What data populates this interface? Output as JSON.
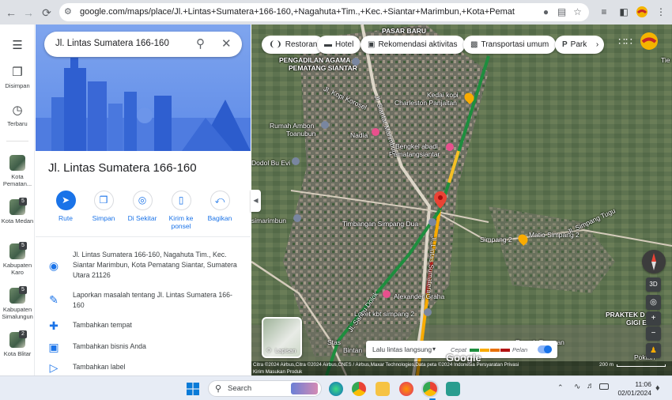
{
  "browser": {
    "url": "google.com/maps/place/Jl.+Lintas+Sumatera+166-160,+Nagahuta+Tim.,+Kec.+Siantar+Marimbun,+Kota+Pematang+Siantar,+Sumatera..."
  },
  "rail": {
    "items": [
      {
        "label": "Disimpan"
      },
      {
        "label": "Terbaru"
      }
    ],
    "recent": [
      {
        "label": "Kota Pematan...",
        "badge": ""
      },
      {
        "label": "Kota Medan",
        "badge": "5"
      },
      {
        "label": "Kabupaten Karo",
        "badge": "5"
      },
      {
        "label": "Kabupaten Simalungun",
        "badge": "5"
      },
      {
        "label": "Kota Blitar",
        "badge": "2"
      }
    ]
  },
  "panel": {
    "search_value": "Jl. Lintas Sumatera 166-160",
    "title": "Jl. Lintas Sumatera 166-160",
    "actions": [
      {
        "label": "Rute"
      },
      {
        "label": "Simpan"
      },
      {
        "label": "Di Sekitar"
      },
      {
        "label": "Kirim ke ponsel"
      },
      {
        "label": "Bagikan"
      }
    ],
    "address": "Jl. Lintas Sumatera 166-160, Nagahuta Tim., Kec. Siantar Marimbun, Kota Pematang Siantar, Sumatera Utara 21126",
    "report": "Laporkan masalah tentang Jl. Lintas Sumatera 166-160",
    "add_place": "Tambahkan tempat",
    "add_business": "Tambahkan bisnis Anda",
    "add_label": "Tambahkan label"
  },
  "map": {
    "chips": [
      {
        "label": "Restoran",
        "icon": "fork-knife-icon"
      },
      {
        "label": "Hotel",
        "icon": "bed-icon"
      },
      {
        "label": "Rekomendasi aktivitas",
        "icon": "camera-icon"
      },
      {
        "label": "Transportasi umum",
        "icon": "bus-icon"
      },
      {
        "label": "Park",
        "icon": "parking-icon"
      }
    ],
    "labels": {
      "pasar_baru": "PASAR BARU",
      "pengadilan_1": "PENGADILAN AGAMA",
      "pengadilan_2": "PEMATANG SIANTAR",
      "kedai_1": "Kedai kopi",
      "kedai_2": "Charleston Panjaitan",
      "rumah_ambon_1": "Rumah Ambon",
      "rumah_ambon_2": "Toanubun",
      "nadia": "Nadia",
      "bengkel_1": "Bengkel abadi",
      "bengkel_2": "Pematangsiantar",
      "dodol": "Dodol Bu Evi",
      "simarimbun": "simarimbun",
      "timbangan": "Timbangan Simpang Dua",
      "simpang2": "Simpang 2",
      "matio": "Matio Simpang 2",
      "alexander": "Alexander Graha",
      "loket": "Loket kbt simpang 2",
      "stas": "Stas",
      "bintan": "Bintan",
      "rumah_pagaran": "Rumah Pagaran",
      "praktek_1": "PRAKTEK D",
      "praktek_2": "GIGI E",
      "poktan": "Poktan",
      "tie": "Tie"
    },
    "road_labels": {
      "jl_lintas": "Jl. Lintas Sumatera",
      "jl_siantar": "Jl. Siantar Marimbun",
      "jl_saribu": "Jl. Saribu Dolok",
      "jl_simpang": "Jl. Simpang Tugu",
      "jl_kopi": "Jl. Kopi Korosel"
    },
    "layers_label": "Lapisan",
    "traffic_label": "Lalu lintas langsung",
    "fast_label": "Cepat",
    "slow_label": "Pelan",
    "btn_3d": "3D",
    "attribution": "Citra ©2024 Airbus,Citra ©2024 Airbus,CNES / Airbus,Maxar Technologies,Data peta ©2024   Indonesia   Persyaratan   Privasi",
    "attribution_2": "Kirim Masukan Produk",
    "scale": "200 m",
    "google": "Google"
  },
  "taskbar": {
    "search_placeholder": "Search",
    "time": "11:06",
    "date": "02/01/2024"
  }
}
